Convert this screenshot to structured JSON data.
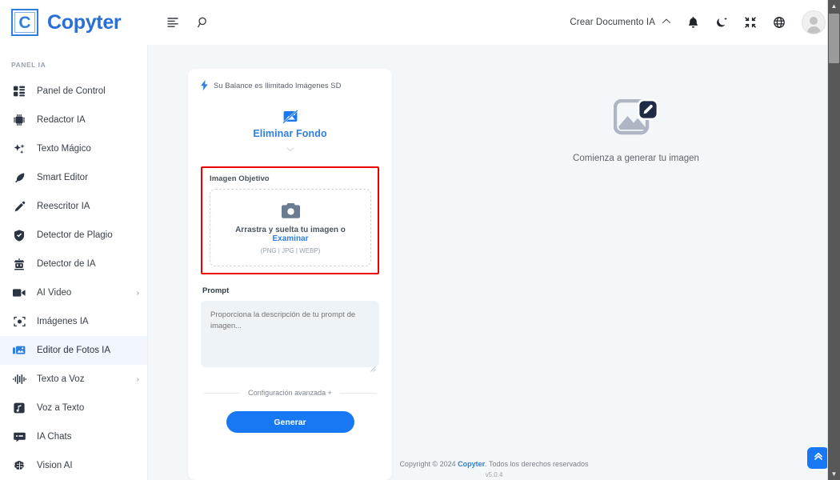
{
  "header": {
    "brand_initial": "C",
    "brand_name": "Copyter",
    "menu_icon": "menu-list-icon",
    "search_icon": "search-icon",
    "create_doc_label": "Crear Documento IA",
    "chevron_up": "⌃",
    "notification_icon": "bell-icon",
    "theme_icon": "moon-icon",
    "fullscreen_icon": "compress-icon",
    "language_icon": "globe-icon",
    "avatar_icon": "user-avatar"
  },
  "sidebar": {
    "section_label": "PANEL IA",
    "items": [
      {
        "label": "Panel de Control",
        "icon": "dashboard-grid-icon",
        "active": false,
        "has_arrow": false
      },
      {
        "label": "Redactor IA",
        "icon": "ai-chip-icon",
        "active": false,
        "has_arrow": false
      },
      {
        "label": "Texto Mágico",
        "icon": "sparkles-icon",
        "active": false,
        "has_arrow": false
      },
      {
        "label": "Smart Editor",
        "icon": "feather-pen-icon",
        "active": false,
        "has_arrow": false
      },
      {
        "label": "Reescritor IA",
        "icon": "pencil-icon",
        "active": false,
        "has_arrow": false
      },
      {
        "label": "Detector de Plagio",
        "icon": "shield-check-icon",
        "active": false,
        "has_arrow": false
      },
      {
        "label": "Detector de IA",
        "icon": "robot-icon",
        "active": false,
        "has_arrow": false
      },
      {
        "label": "AI Video",
        "icon": "video-camera-icon",
        "active": false,
        "has_arrow": true
      },
      {
        "label": "Imágenes IA",
        "icon": "camera-frame-icon",
        "active": false,
        "has_arrow": false
      },
      {
        "label": "Editor de Fotos IA",
        "icon": "photo-edit-icon",
        "active": true,
        "has_arrow": false
      },
      {
        "label": "Texto a Voz",
        "icon": "waveform-icon",
        "active": false,
        "has_arrow": true
      },
      {
        "label": "Voz a Texto",
        "icon": "music-note-icon",
        "active": false,
        "has_arrow": false
      },
      {
        "label": "IA Chats",
        "icon": "chat-bubble-icon",
        "active": false,
        "has_arrow": false
      },
      {
        "label": "Vision AI",
        "icon": "brain-icon",
        "active": false,
        "has_arrow": false
      }
    ]
  },
  "card": {
    "balance_text": "Su Balance es Ilimitado Imágenes SD",
    "balance_icon": "lightning-bolt-icon",
    "tool_icon": "image-remove-background-icon",
    "tool_name": "Eliminar Fondo",
    "tool_caret": "▾",
    "target_image_label": "Imagen Objetivo",
    "dropzone": {
      "icon": "camera-icon",
      "text_prefix": "Arrastra y suelta tu imagen o ",
      "browse_label": "Examinar",
      "formats": "(PNG | JPG | WEBP)"
    },
    "prompt_label": "Prompt",
    "prompt_placeholder": "Proporciona la descripción de tu prompt de imagen...",
    "prompt_value": "",
    "advanced_label": "Configuración avanzada +",
    "generate_label": "Generar"
  },
  "preview": {
    "icon": "image-edit-placeholder-icon",
    "text": "Comienza a generar tu imagen"
  },
  "footer": {
    "copyright_prefix": "Copyright © 2024 ",
    "brand": "Copyter",
    "copyright_suffix": ". Todos los derechos reservados",
    "version": "v5.0.4"
  },
  "scroll_top": {
    "icon": "double-chevron-up-icon"
  },
  "colors": {
    "accent_blue": "#1877f2",
    "brand_blue": "#2f7fe0",
    "highlight_red": "#ee0000",
    "page_bg": "#f4f7fa",
    "card_bg": "#ffffff",
    "active_nav_bg": "#f1f6fc"
  }
}
